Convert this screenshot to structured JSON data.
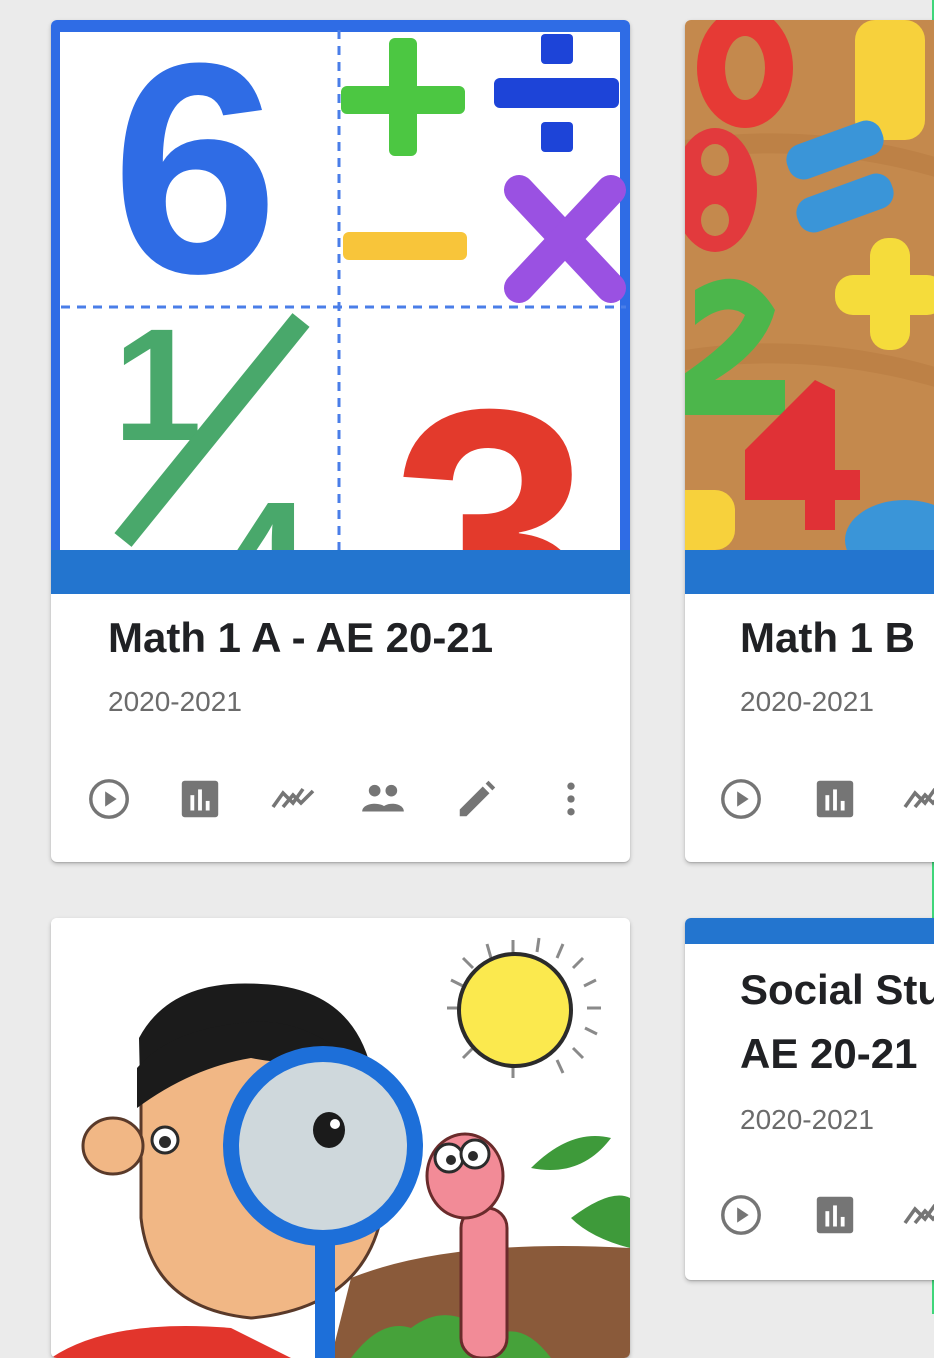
{
  "cards": [
    {
      "title": "Math 1 A - AE 20-21",
      "subtitle": "2020-2021",
      "image": "math-symbols-image",
      "actions": [
        "play-icon",
        "stats-icon",
        "trend-icon",
        "people-icon",
        "edit-icon",
        "more-vert-icon"
      ]
    },
    {
      "title": "Math 1 B",
      "subtitle": "2020-2021",
      "image": "wooden-numbers-image",
      "actions": [
        "play-icon",
        "stats-icon",
        "trend-icon"
      ]
    },
    {
      "title": "",
      "subtitle": "",
      "image": "boy-magnifier-image",
      "actions": []
    },
    {
      "title_line1": "Social Stu",
      "title_line2": "AE 20-21",
      "subtitle": "2020-2021",
      "actions": [
        "play-icon",
        "stats-icon",
        "trend-icon"
      ]
    }
  ],
  "colors": {
    "accent_blue": "#2375cf",
    "background": "#ebebeb",
    "card": "#ffffff",
    "icon_gray": "#757575"
  }
}
